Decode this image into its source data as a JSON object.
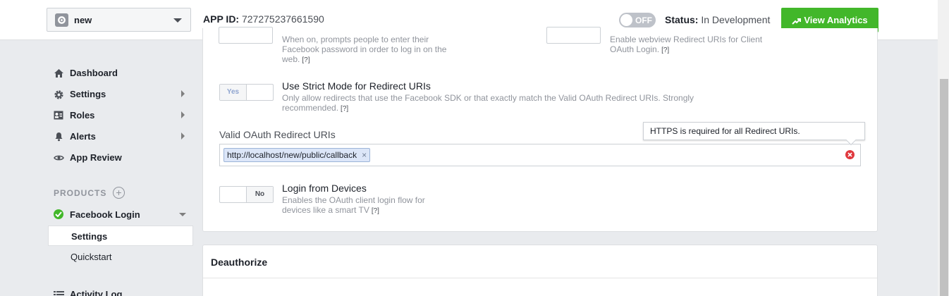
{
  "header": {
    "app_name": "new",
    "app_id_label": "APP ID:",
    "app_id_value": "727275237661590",
    "toggle_label": "OFF",
    "status_label": "Status:",
    "status_value": "In Development",
    "analytics_button": "View Analytics"
  },
  "sidebar": {
    "items": [
      {
        "label": "Dashboard",
        "icon": "home-icon"
      },
      {
        "label": "Settings",
        "icon": "gear-icon"
      },
      {
        "label": "Roles",
        "icon": "roles-icon"
      },
      {
        "label": "Alerts",
        "icon": "bell-icon"
      },
      {
        "label": "App Review",
        "icon": "eye-icon"
      }
    ],
    "products_label": "PRODUCTS",
    "add_symbol": "+",
    "product": {
      "label": "Facebook Login",
      "icon": "check-icon"
    },
    "sub_items": [
      "Settings",
      "Quickstart"
    ],
    "activity_log": "Activity Log"
  },
  "main": {
    "partial_left_desc_top": "When on, prompts people to enter their",
    "partial_left_desc_2": "Facebook password in order to log in on the",
    "partial_left_desc_3": "web.",
    "partial_right_desc_top": "Enable webview Redirect URIs for Client",
    "partial_right_desc_2": "OAuth Login.",
    "help": "[?]",
    "strict_mode": {
      "toggle_yes": "Yes",
      "title": "Use Strict Mode for Redirect URIs",
      "desc_1": "Only allow redirects that use the Facebook SDK or that exactly match the Valid OAuth Redirect URIs. Strongly",
      "desc_2": "recommended."
    },
    "redirect_label": "Valid OAuth Redirect URIs",
    "redirect_token": "http://localhost/new/public/callback",
    "token_remove": "×",
    "tooltip": "HTTPS is required for all Redirect URIs.",
    "devices": {
      "toggle_no": "No",
      "title": "Login from Devices",
      "desc_1": "Enables the OAuth client login flow for",
      "desc_2": "devices like a smart TV"
    }
  },
  "deauthorize": {
    "title": "Deauthorize"
  }
}
